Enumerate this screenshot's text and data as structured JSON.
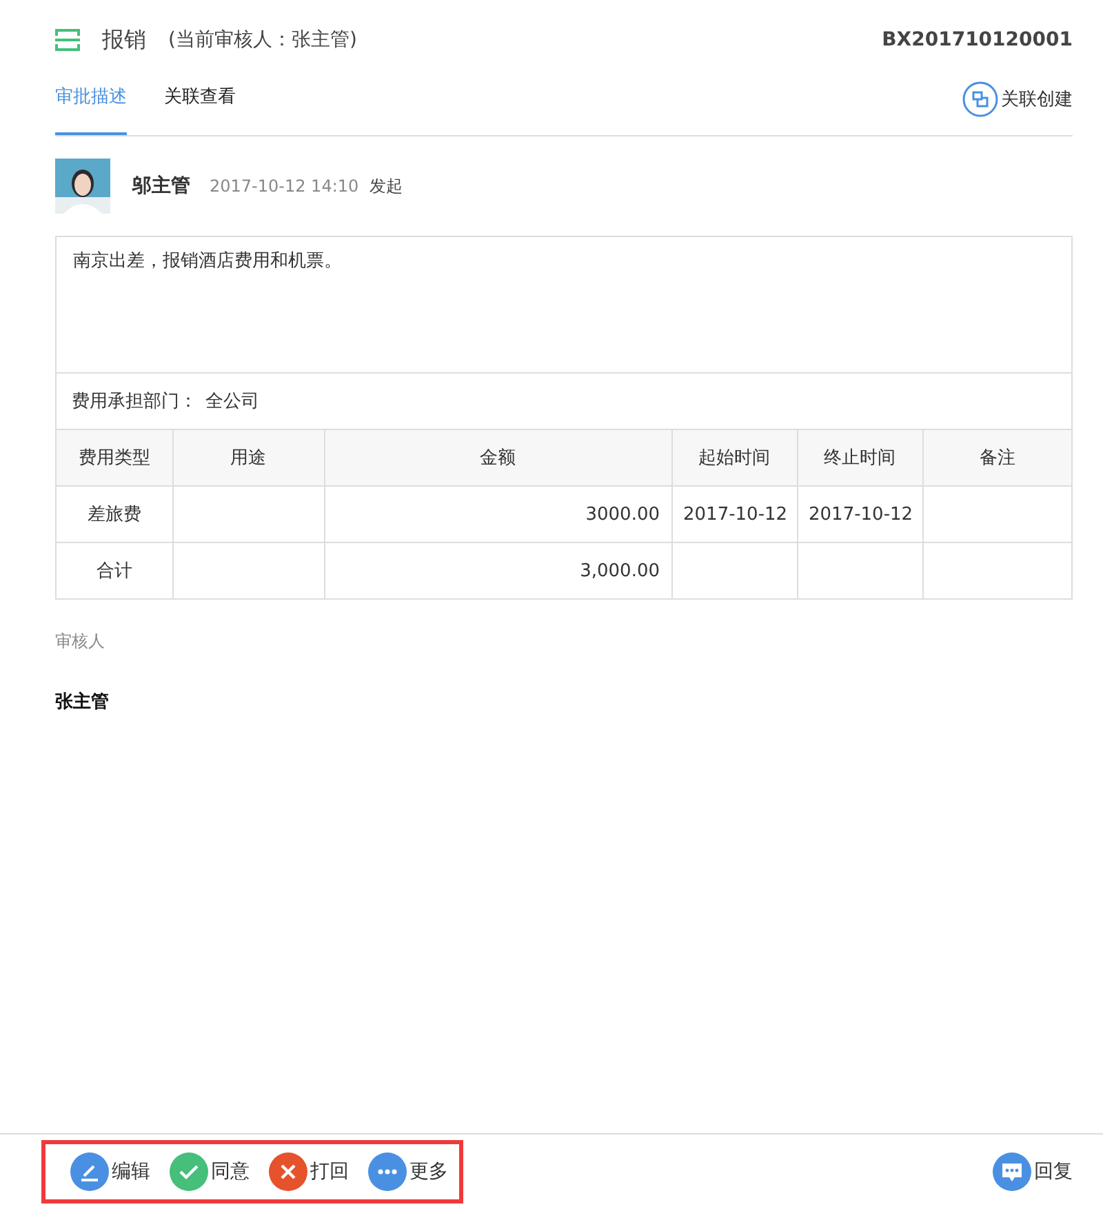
{
  "header": {
    "title": "报销",
    "reviewer_note": "(当前审核人：张主管)",
    "doc_number": "BX201710120001"
  },
  "tabs": [
    {
      "label": "审批描述",
      "selected": true
    },
    {
      "label": "关联查看",
      "selected": false
    }
  ],
  "link_create": {
    "label": "关联创建"
  },
  "submission": {
    "name": "邬主管",
    "time": "2017-10-12 14:10",
    "action": "发起"
  },
  "description": "南京出差，报销酒店费用和机票。",
  "department": {
    "label": "费用承担部门：",
    "value": "全公司"
  },
  "table": {
    "columns": [
      "费用类型",
      "用途",
      "金额",
      "起始时间",
      "终止时间",
      "备注"
    ],
    "rows": [
      [
        "差旅费",
        "",
        "3000.00",
        "2017-10-12",
        "2017-10-12",
        ""
      ],
      [
        "合计",
        "",
        "3,000.00",
        "",
        "",
        ""
      ]
    ]
  },
  "reviewers": {
    "label": "审核人",
    "names": [
      "张主管"
    ]
  },
  "actions": [
    {
      "kind": "edit",
      "label": "编辑"
    },
    {
      "kind": "agree",
      "label": "同意"
    },
    {
      "kind": "reject",
      "label": "打回"
    },
    {
      "kind": "more",
      "label": "更多"
    }
  ],
  "reply": {
    "label": "回复"
  }
}
